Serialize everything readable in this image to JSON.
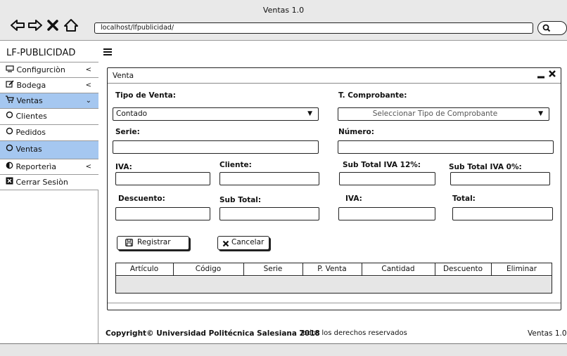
{
  "window": {
    "title": "Ventas 1.0"
  },
  "browser": {
    "url": "localhost/lfpublicidad/",
    "icons": [
      "back-arrow-icon",
      "forward-arrow-icon",
      "close-x-icon",
      "home-icon",
      "search-icon"
    ]
  },
  "app": {
    "brand": "LF-PUBLICIDAD",
    "menu_icon": "hamburger-icon"
  },
  "sidebar": {
    "items": [
      {
        "label": "Configurciòn",
        "icon": "monitor-icon",
        "chevron": "<"
      },
      {
        "label": "Bodega",
        "icon": "edit-icon",
        "chevron": "<"
      },
      {
        "label": "Ventas",
        "icon": "cart-icon",
        "chevron": "⌄"
      },
      {
        "label": "Clientes",
        "icon": "circle-icon"
      },
      {
        "label": "Pedidos",
        "icon": "circle-icon"
      },
      {
        "label": "Ventas",
        "icon": "circle-icon"
      },
      {
        "label": "Reporterìa",
        "icon": "half-circle-icon",
        "chevron": "<"
      },
      {
        "label": "Cerrar Sesiòn",
        "icon": "close-box-icon"
      }
    ]
  },
  "panel": {
    "title": "Venta",
    "tipo_venta": {
      "label": "Tipo de Venta:",
      "value": "Contado"
    },
    "comprobante": {
      "label": "T. Comprobante:",
      "placeholder": "Seleccionar Tipo de Comprobante"
    },
    "serie": {
      "label": "Serie:",
      "value": ""
    },
    "numero": {
      "label": "Número:",
      "value": ""
    },
    "iva": {
      "label": "IVA:",
      "value": ""
    },
    "cliente": {
      "label": "Cliente:",
      "value": ""
    },
    "subtotal_iva12": {
      "label": "Sub Total IVA 12%:",
      "value": ""
    },
    "subtotal_iva0": {
      "label": "Sub Total IVA 0%:",
      "value": ""
    },
    "descuento": {
      "label": "Descuento:",
      "value": ""
    },
    "subtotal": {
      "label": "Sub Total:",
      "value": ""
    },
    "iva2": {
      "label": "IVA:",
      "value": ""
    },
    "total": {
      "label": "Total:",
      "value": ""
    },
    "buttons": {
      "register": "Registrar",
      "cancel": "Cancelar"
    },
    "table": {
      "columns": [
        "Artículo",
        "Código",
        "Serie",
        "P. Venta",
        "Cantidad",
        "Descuento",
        "Eliminar"
      ],
      "rows": []
    }
  },
  "footer": {
    "copyright": "Copyright© Universidad Politécnica Salesiana 2018",
    "rights": "Todos los derechos reservados",
    "version": "Ventas 1.0"
  },
  "colors": {
    "active_item": "#a5c7f0",
    "chrome": "#e9e9e9",
    "table_body": "#e6e6e6"
  }
}
